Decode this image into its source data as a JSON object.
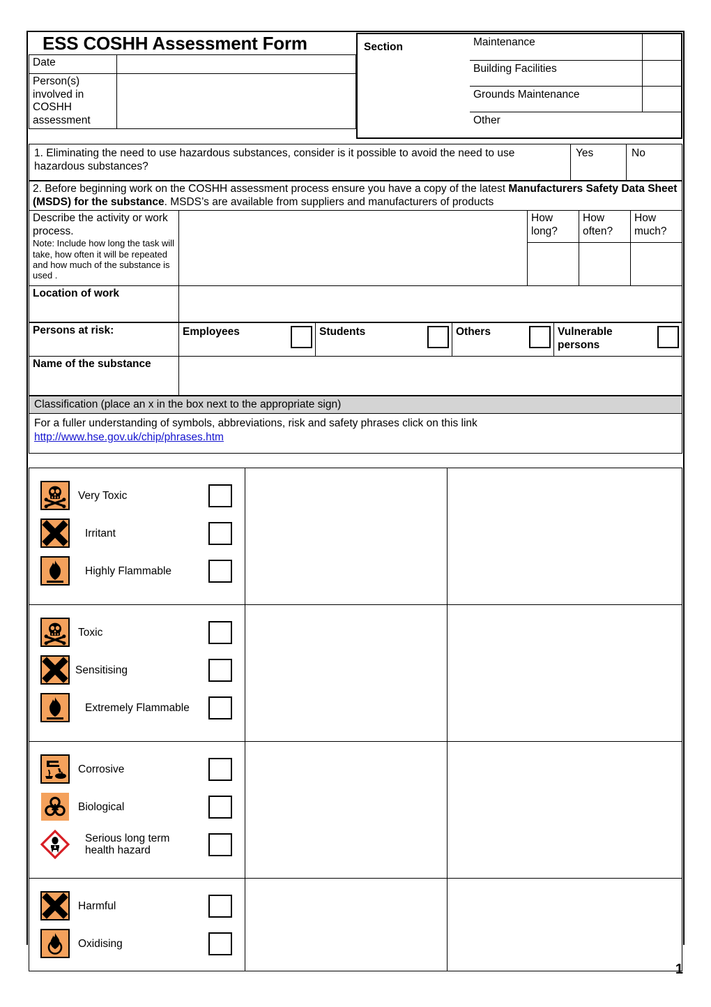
{
  "document": {
    "title": "ESS COSHH Assessment Form",
    "page_number": "1"
  },
  "header": {
    "date_label": "Date",
    "date_value": "",
    "persons_label": "Person(s) involved in COSHH assessment",
    "persons_value": "",
    "section_label": "Section",
    "section_options": [
      {
        "label": "Maintenance",
        "checked": ""
      },
      {
        "label": "Building Facilities",
        "checked": ""
      },
      {
        "label": "Grounds Maintenance",
        "checked": ""
      }
    ],
    "other_label": "Other",
    "other_value": ""
  },
  "questions": {
    "q1_text": "1. Eliminating the need to use hazardous substances, consider is it possible to avoid the need to use hazardous substances?",
    "q1_yes": "Yes",
    "q1_no": "No",
    "q1_yes_value": "",
    "q1_no_value": "",
    "q2_part1": "2. Before beginning work on the COSHH assessment process ensure you have a copy of the latest ",
    "q2_bold1": "Manufacturers Safety Data Sheet (MSDS) for the substance",
    "q2_part2": ". MSDS’s are available from suppliers and manufacturers of products"
  },
  "activity": {
    "label_main": "Describe the activity or work process.",
    "label_note": "Note: Include how long the task will take, how often it will be repeated and how much of the substance is used .",
    "value": "",
    "how_long": "How long?",
    "how_often": "How often?",
    "how_much": "How much?",
    "how_long_value": "",
    "how_often_value": "",
    "how_much_value": ""
  },
  "location": {
    "label": "Location of work",
    "value": ""
  },
  "persons_at_risk": {
    "label": "Persons at risk:",
    "options": [
      {
        "label": "Employees",
        "checked": ""
      },
      {
        "label": "Students",
        "checked": ""
      },
      {
        "label": "Others",
        "checked": ""
      },
      {
        "label": "Vulnerable persons",
        "checked": ""
      }
    ]
  },
  "substance": {
    "label": "Name of the substance",
    "value": ""
  },
  "classification": {
    "bar_title": "Classification (place an x in the box next to the appropriate sign)",
    "intro_text": "For a fuller understanding of symbols, abbreviations, risk and safety phrases click on this link",
    "link_text": "http://www.hse.gov.uk/chip/phrases.htm",
    "bar_bg_color": "#d4d4d4",
    "link_color": "#1414cf",
    "hazard_orange": "#F4A15C",
    "ghs_red": "#D81E25",
    "groups": [
      {
        "items": [
          {
            "label": "Very Toxic",
            "icon": "skull-crossbones-icon",
            "checked": ""
          },
          {
            "label": "Irritant",
            "icon": "saint-andrews-cross-icon",
            "checked": ""
          },
          {
            "label": "Highly Flammable",
            "icon": "flame-icon",
            "checked": ""
          }
        ],
        "notes": "",
        "extra": ""
      },
      {
        "items": [
          {
            "label": "Toxic",
            "icon": "skull-crossbones-icon",
            "checked": ""
          },
          {
            "label": "Sensitising",
            "icon": "saint-andrews-cross-icon",
            "checked": ""
          },
          {
            "label": "Extremely Flammable",
            "icon": "flame-icon",
            "checked": ""
          }
        ],
        "notes": "",
        "extra": ""
      },
      {
        "items": [
          {
            "label": "Corrosive",
            "icon": "corrosion-icon",
            "checked": ""
          },
          {
            "label": "Biological",
            "icon": "biohazard-icon",
            "checked": ""
          },
          {
            "label": "Serious long term health hazard",
            "icon": "ghs-health-hazard-icon",
            "checked": ""
          }
        ],
        "notes": "",
        "extra": ""
      },
      {
        "items": [
          {
            "label": "Harmful",
            "icon": "saint-andrews-cross-icon",
            "checked": ""
          },
          {
            "label": "Oxidising",
            "icon": "oxidising-flame-circle-icon",
            "checked": ""
          }
        ],
        "notes": "",
        "extra": ""
      }
    ]
  }
}
